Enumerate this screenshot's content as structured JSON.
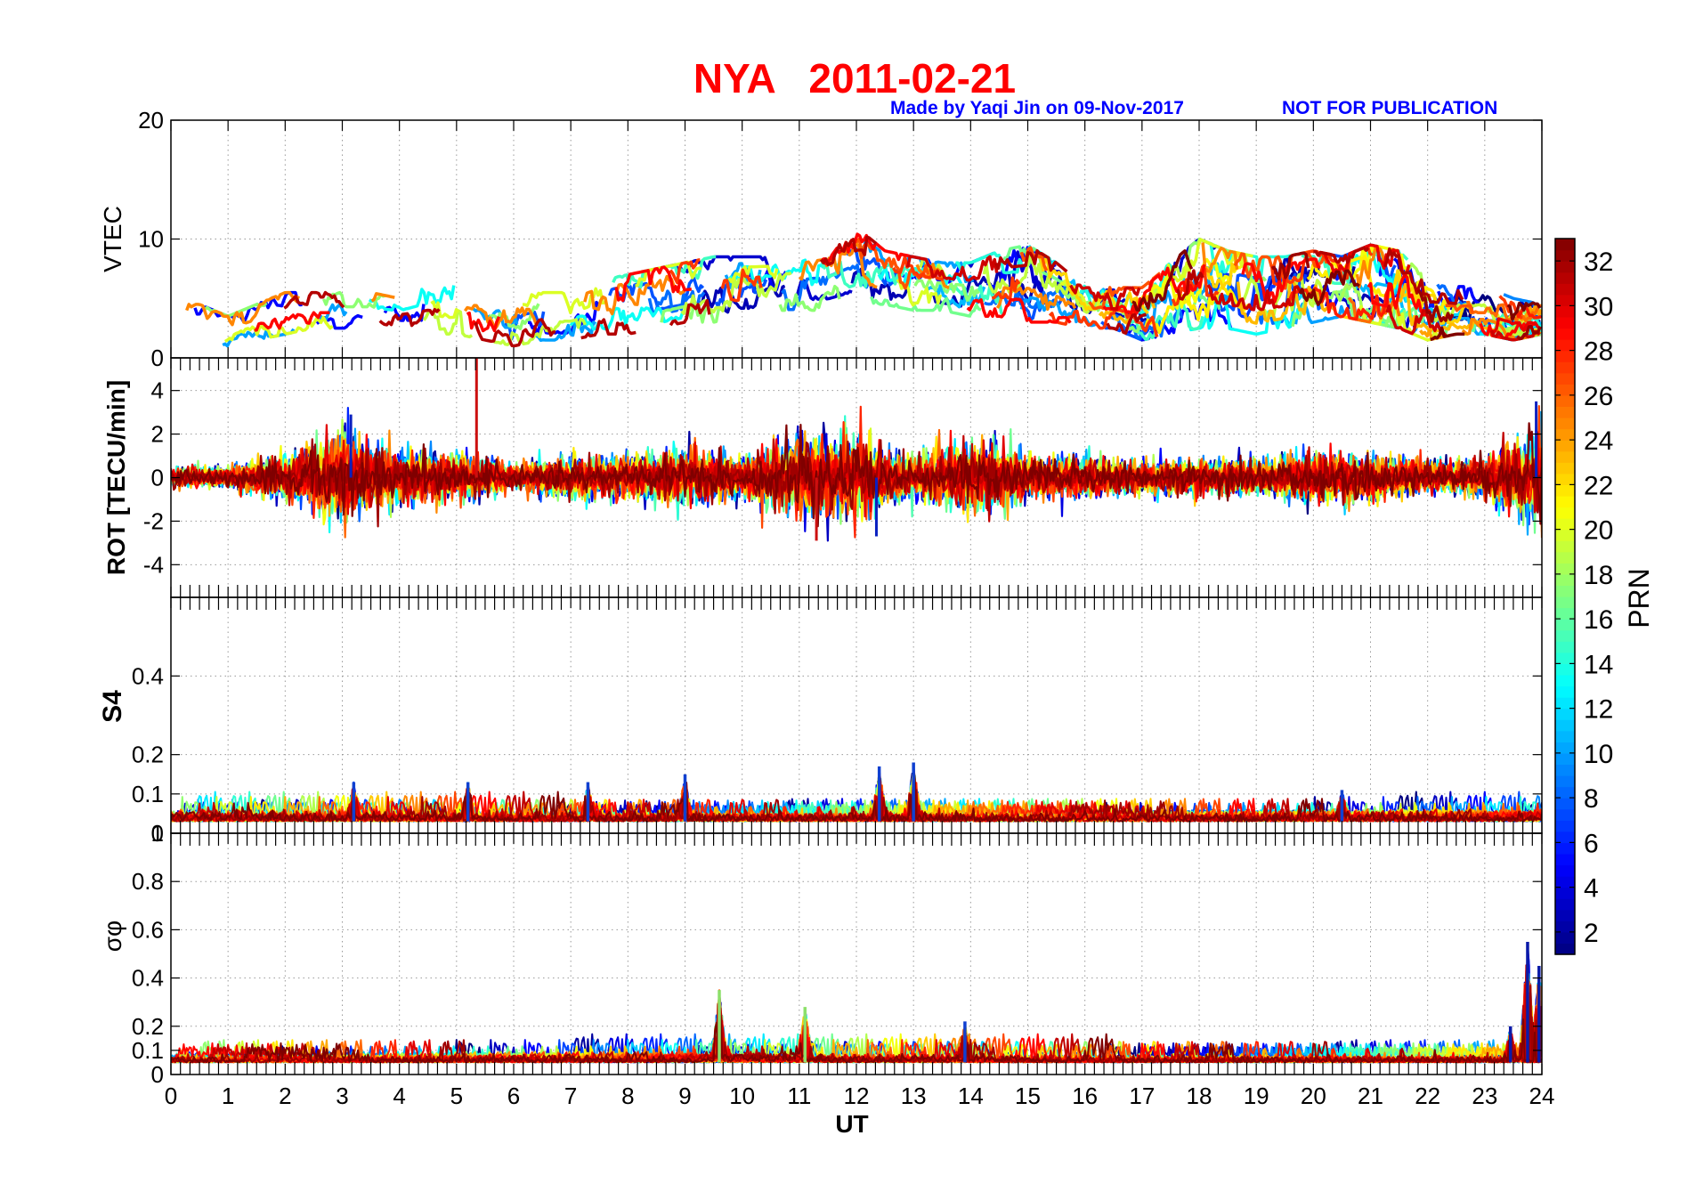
{
  "header": {
    "title": "NYA   2011-02-21",
    "credit": "Made by Yaqi Jin on 09-Nov-2017",
    "notice": "NOT FOR PUBLICATION",
    "title_color": "#ff0000",
    "credit_color": "#0000ff"
  },
  "x_axis": {
    "label": "UT",
    "range": [
      0,
      24
    ],
    "ticks": [
      "0",
      "1",
      "2",
      "3",
      "4",
      "5",
      "6",
      "7",
      "8",
      "9",
      "10",
      "11",
      "12",
      "13",
      "14",
      "15",
      "16",
      "17",
      "18",
      "19",
      "20",
      "21",
      "22",
      "23",
      "24"
    ]
  },
  "colorbar": {
    "label": "PRN",
    "colormap": "jet",
    "range": [
      1,
      33
    ],
    "ticks": [
      "2",
      "4",
      "6",
      "8",
      "10",
      "12",
      "14",
      "16",
      "18",
      "20",
      "22",
      "24",
      "26",
      "28",
      "30",
      "32"
    ]
  },
  "chart_data": [
    {
      "type": "line",
      "panel": "vtec",
      "ylabel": "VTEC",
      "ylim": [
        0,
        20
      ],
      "yticks": [
        "0",
        "10",
        "20"
      ],
      "grid": true,
      "x": [
        0,
        0.5,
        1,
        1.5,
        2,
        2.5,
        3,
        3.5,
        4,
        4.5,
        5,
        5.5,
        6,
        6.5,
        7,
        7.5,
        8,
        8.5,
        9,
        9.5,
        10,
        10.5,
        11,
        11.5,
        12,
        12.5,
        13,
        13.5,
        14,
        14.5,
        15,
        15.5,
        16,
        16.5,
        17,
        17.5,
        18,
        18.5,
        19,
        19.5,
        20,
        20.5,
        21,
        21.5,
        22,
        22.5,
        23,
        23.5,
        24
      ],
      "series_summary": {
        "typical_min": [
          2,
          1,
          1,
          1.5,
          2,
          2.5,
          2.5,
          2.5,
          2.5,
          2,
          2,
          1.5,
          1,
          1.5,
          1.5,
          2,
          2,
          2.5,
          3,
          3,
          3.5,
          4,
          4,
          4,
          4.5,
          4.5,
          4,
          4,
          3.5,
          3.5,
          3,
          3,
          2.5,
          2.5,
          1.5,
          2,
          2.5,
          2.5,
          2,
          2.5,
          3,
          3.5,
          3,
          2.5,
          1.5,
          2,
          2,
          1.5,
          2
        ],
        "typical_max": [
          4.5,
          4.5,
          3.5,
          4.5,
          5.5,
          5.5,
          5.5,
          5.5,
          5,
          6.5,
          7,
          4.5,
          5,
          5.5,
          5.5,
          6.5,
          7,
          7.5,
          8,
          8.5,
          8.5,
          8.5,
          9,
          9.5,
          11,
          9,
          8.5,
          8,
          8,
          9,
          9.5,
          8,
          6,
          6,
          6,
          8,
          10,
          9,
          8.5,
          8.5,
          9,
          8.5,
          9.5,
          9,
          6.5,
          6,
          6,
          5,
          4.5
        ]
      }
    },
    {
      "type": "line",
      "panel": "rot",
      "ylabel": "ROT [TECU/min]",
      "ylim": [
        -5.5,
        5.5
      ],
      "yticks": [
        "-4",
        "-2",
        "0",
        "2",
        "4"
      ],
      "grid": true,
      "envelope_hours": [
        0,
        1,
        2,
        3,
        4,
        5,
        6,
        7,
        8,
        9,
        10,
        11,
        12,
        13,
        14,
        15,
        16,
        17,
        18,
        19,
        20,
        21,
        22,
        23,
        24
      ],
      "envelope_amplitude": [
        0.6,
        0.7,
        1.4,
        2.8,
        1.6,
        1.5,
        0.8,
        1.4,
        1.3,
        1.8,
        1.3,
        2.5,
        2.7,
        1.3,
        2.4,
        1.5,
        1.2,
        1.0,
        1.2,
        1.1,
        1.6,
        1.5,
        1.0,
        1.2,
        3.4
      ],
      "notable_spikes": [
        {
          "x": 5.35,
          "y": 5.5
        },
        {
          "x": 3.15,
          "y": 2.9
        },
        {
          "x": 12.35,
          "y": -2.7
        },
        {
          "x": 23.9,
          "y": 3.5
        },
        {
          "x": 11.3,
          "y": -2.9
        }
      ]
    },
    {
      "type": "line",
      "panel": "s4",
      "ylabel": "S4",
      "ylim": [
        0,
        0.6
      ],
      "yticks": [
        "0",
        "0.1",
        "0.2",
        "0.4"
      ],
      "grid": true,
      "baseline": 0.03,
      "notable_peaks": [
        {
          "x": 12.4,
          "y": 0.17
        },
        {
          "x": 13.0,
          "y": 0.18
        },
        {
          "x": 9.0,
          "y": 0.15
        },
        {
          "x": 3.2,
          "y": 0.13
        },
        {
          "x": 5.2,
          "y": 0.13
        },
        {
          "x": 20.5,
          "y": 0.11
        },
        {
          "x": 7.3,
          "y": 0.13
        }
      ]
    },
    {
      "type": "line",
      "panel": "sigma_phi",
      "ylabel": "σφ",
      "ylim": [
        0,
        1
      ],
      "yticks": [
        "0",
        "0.1",
        "0.2",
        "0.4",
        "0.6",
        "0.8",
        "1"
      ],
      "grid": true,
      "baseline": 0.05,
      "notable_peaks": [
        {
          "x": 23.75,
          "y": 0.55
        },
        {
          "x": 23.95,
          "y": 0.45
        },
        {
          "x": 9.6,
          "y": 0.35
        },
        {
          "x": 11.1,
          "y": 0.28
        },
        {
          "x": 13.9,
          "y": 0.22
        },
        {
          "x": 23.45,
          "y": 0.2
        }
      ]
    }
  ]
}
